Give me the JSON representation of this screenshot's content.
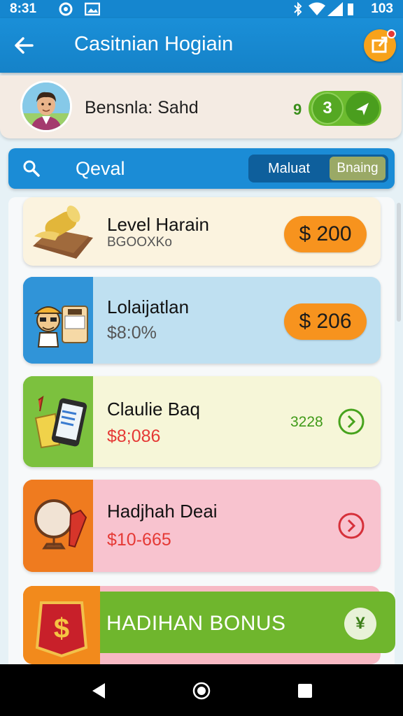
{
  "status_bar": {
    "time": "8:31",
    "battery": "103"
  },
  "app_bar": {
    "title": "Casitnian Hogiain"
  },
  "profile": {
    "name": "Bensnla: Sahd",
    "count_small": "9",
    "count_badge": "3"
  },
  "search": {
    "placeholder": "Qeval",
    "toggle_a": "Maluat",
    "toggle_b": "Bnaing"
  },
  "cards": [
    {
      "title": "Level Harain",
      "subtitle": "BGOOXKo",
      "price": "$ 200",
      "bg": "#fbf3df"
    },
    {
      "title": "Lolaijatlan",
      "subtitle": "$8:0%",
      "price": "$ 206",
      "bg": "#bfe0f1"
    },
    {
      "title": "Claulie Baq",
      "subtitle": "$8;086",
      "value": "3228",
      "bg": "#f6f6d8"
    },
    {
      "title": "Hadjhah Deai",
      "subtitle": "$10-665",
      "bg": "#f8c3cf"
    }
  ],
  "bonus": {
    "label": "HADIHAN BONUS",
    "button_symbol": "¥"
  },
  "colors": {
    "primary": "#1a8fd8",
    "accent_orange": "#f7931e",
    "green": "#6cbb2f",
    "red_text": "#e53935"
  }
}
